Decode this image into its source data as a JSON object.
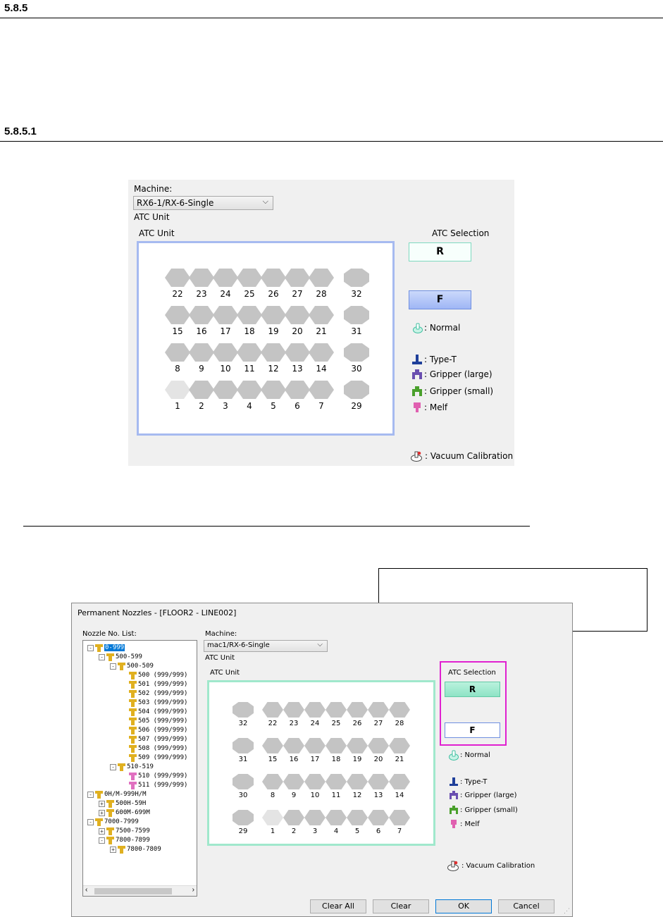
{
  "sections": {
    "h1": "5.8.5",
    "h2": "5.8.5.1"
  },
  "top_panel": {
    "machine_label": "Machine:",
    "machine_value": "RX6-1/RX-6-Single",
    "atc_unit_label": "ATC Unit",
    "atc_unit_group": "ATC Unit",
    "atc_selection_label": "ATC Selection",
    "btn_r": "R",
    "btn_f": "F",
    "slot_rows": [
      [
        "22",
        "23",
        "24",
        "25",
        "26",
        "27",
        "28",
        "32"
      ],
      [
        "15",
        "16",
        "17",
        "18",
        "19",
        "20",
        "21",
        "31"
      ],
      [
        "8",
        "9",
        "10",
        "11",
        "12",
        "13",
        "14",
        "30"
      ],
      [
        "1",
        "2",
        "3",
        "4",
        "5",
        "6",
        "7",
        "29"
      ]
    ],
    "legend": {
      "normal": ": Normal",
      "type_t": ": Type-T",
      "gripper_large": ": Gripper (large)",
      "gripper_small": ": Gripper (small)",
      "melf": ": Melf",
      "vacuum": ": Vacuum Calibration"
    }
  },
  "dialog": {
    "title": "Permanent Nozzles - [FLOOR2 - LINE002]",
    "nozzle_list_label": "Nozzle No. List:",
    "machine_label": "Machine:",
    "machine_value": "mac1/RX-6-Single",
    "atc_unit_label": "ATC Unit",
    "atc_unit_group": "ATC Unit",
    "atc_selection_label": "ATC Selection",
    "btn_r": "R",
    "btn_f": "F",
    "slot_rows": [
      [
        "32",
        "22",
        "23",
        "24",
        "25",
        "26",
        "27",
        "28"
      ],
      [
        "31",
        "15",
        "16",
        "17",
        "18",
        "19",
        "20",
        "21"
      ],
      [
        "30",
        "8",
        "9",
        "10",
        "11",
        "12",
        "13",
        "14"
      ],
      [
        "29",
        "1",
        "2",
        "3",
        "4",
        "5",
        "6",
        "7"
      ]
    ],
    "tree": [
      {
        "label": "0-999",
        "pm": "-"
      },
      {
        "label": "500-599",
        "pm": "-"
      },
      {
        "label": "500-509",
        "pm": "-"
      },
      {
        "label": "500 (999/999)",
        "pm": ""
      },
      {
        "label": "501 (999/999)",
        "pm": ""
      },
      {
        "label": "502 (999/999)",
        "pm": ""
      },
      {
        "label": "503 (999/999)",
        "pm": ""
      },
      {
        "label": "504 (999/999)",
        "pm": ""
      },
      {
        "label": "505 (999/999)",
        "pm": ""
      },
      {
        "label": "506 (999/999)",
        "pm": ""
      },
      {
        "label": "507 (999/999)",
        "pm": ""
      },
      {
        "label": "508 (999/999)",
        "pm": ""
      },
      {
        "label": "509 (999/999)",
        "pm": ""
      },
      {
        "label": "510-519",
        "pm": "-"
      },
      {
        "label": "510 (999/999)",
        "pm": ""
      },
      {
        "label": "511 (999/999)",
        "pm": ""
      },
      {
        "label": "0H/M-999H/M",
        "pm": "-"
      },
      {
        "label": "500H-59H",
        "pm": "+"
      },
      {
        "label": "600M-699M",
        "pm": "+"
      },
      {
        "label": "7000-7999",
        "pm": "-"
      },
      {
        "label": "7500-7599",
        "pm": "+"
      },
      {
        "label": "7800-7899",
        "pm": "-"
      },
      {
        "label": "7800-7809",
        "pm": "+"
      }
    ],
    "legend": {
      "normal": ": Normal",
      "type_t": ": Type-T",
      "gripper_large": ": Gripper (large)",
      "gripper_small": ": Gripper (small)",
      "melf": ": Melf",
      "vacuum": ": Vacuum Calibration"
    },
    "buttons": {
      "clear_all": "Clear All",
      "clear": "Clear",
      "ok": "OK",
      "cancel": "Cancel"
    }
  },
  "colors": {
    "type_t": "#1f3f9a",
    "gripper_large": "#6a4fb0",
    "gripper_small": "#4aa02c",
    "melf": "#e060b0",
    "normal": "#3fbfa0",
    "highlight": "#e020d0"
  }
}
